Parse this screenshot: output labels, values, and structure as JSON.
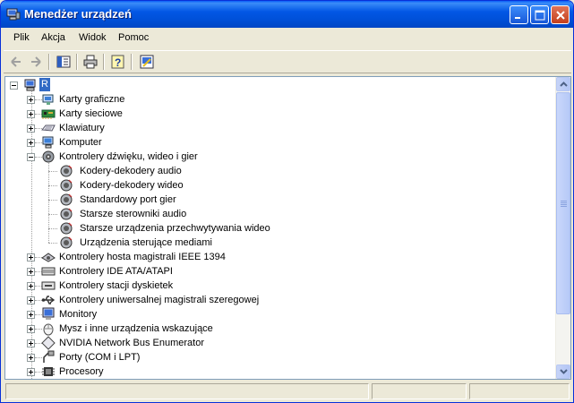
{
  "window": {
    "title": "Menedżer urządzeń"
  },
  "menu": [
    "Plik",
    "Akcja",
    "Widok",
    "Pomoc"
  ],
  "toolbar": [
    "back-arrow",
    "forward-arrow",
    "console-tree",
    "print",
    "help",
    "properties"
  ],
  "tree": {
    "root": "R",
    "items": [
      {
        "label": "Karty graficzne",
        "icon": "display-adapter-icon",
        "expanded": false
      },
      {
        "label": "Karty sieciowe",
        "icon": "network-card-icon",
        "expanded": false
      },
      {
        "label": "Klawiatury",
        "icon": "keyboard-icon",
        "expanded": false
      },
      {
        "label": "Komputer",
        "icon": "computer-icon",
        "expanded": false
      },
      {
        "label": "Kontrolery dźwięku, wideo i gier",
        "icon": "speaker-icon",
        "expanded": true,
        "children": [
          {
            "label": "Kodery-dekodery audio"
          },
          {
            "label": "Kodery-dekodery wideo"
          },
          {
            "label": "Standardowy port gier"
          },
          {
            "label": "Starsze sterowniki audio"
          },
          {
            "label": "Starsze urządzenia przechwytywania wideo"
          },
          {
            "label": "Urządzenia sterujące mediami"
          }
        ]
      },
      {
        "label": "Kontrolery hosta magistrali IEEE 1394",
        "icon": "ieee1394-icon",
        "expanded": false
      },
      {
        "label": "Kontrolery IDE ATA/ATAPI",
        "icon": "ide-controller-icon",
        "expanded": false
      },
      {
        "label": "Kontrolery stacji dyskietek",
        "icon": "floppy-controller-icon",
        "expanded": false
      },
      {
        "label": "Kontrolery uniwersalnej magistrali szeregowej",
        "icon": "usb-icon",
        "expanded": false
      },
      {
        "label": "Monitory",
        "icon": "monitor-icon",
        "expanded": false
      },
      {
        "label": "Mysz i inne urządzenia wskazujące",
        "icon": "mouse-icon",
        "expanded": false
      },
      {
        "label": "NVIDIA Network Bus Enumerator",
        "icon": "bus-enumerator-icon",
        "expanded": false
      },
      {
        "label": "Porty (COM i LPT)",
        "icon": "port-icon",
        "expanded": false
      },
      {
        "label": "Procesory",
        "icon": "processor-icon",
        "expanded": false
      }
    ]
  },
  "colors": {
    "titlebar": "#0054e3",
    "selection": "#316ac5",
    "face": "#ece9d8"
  }
}
